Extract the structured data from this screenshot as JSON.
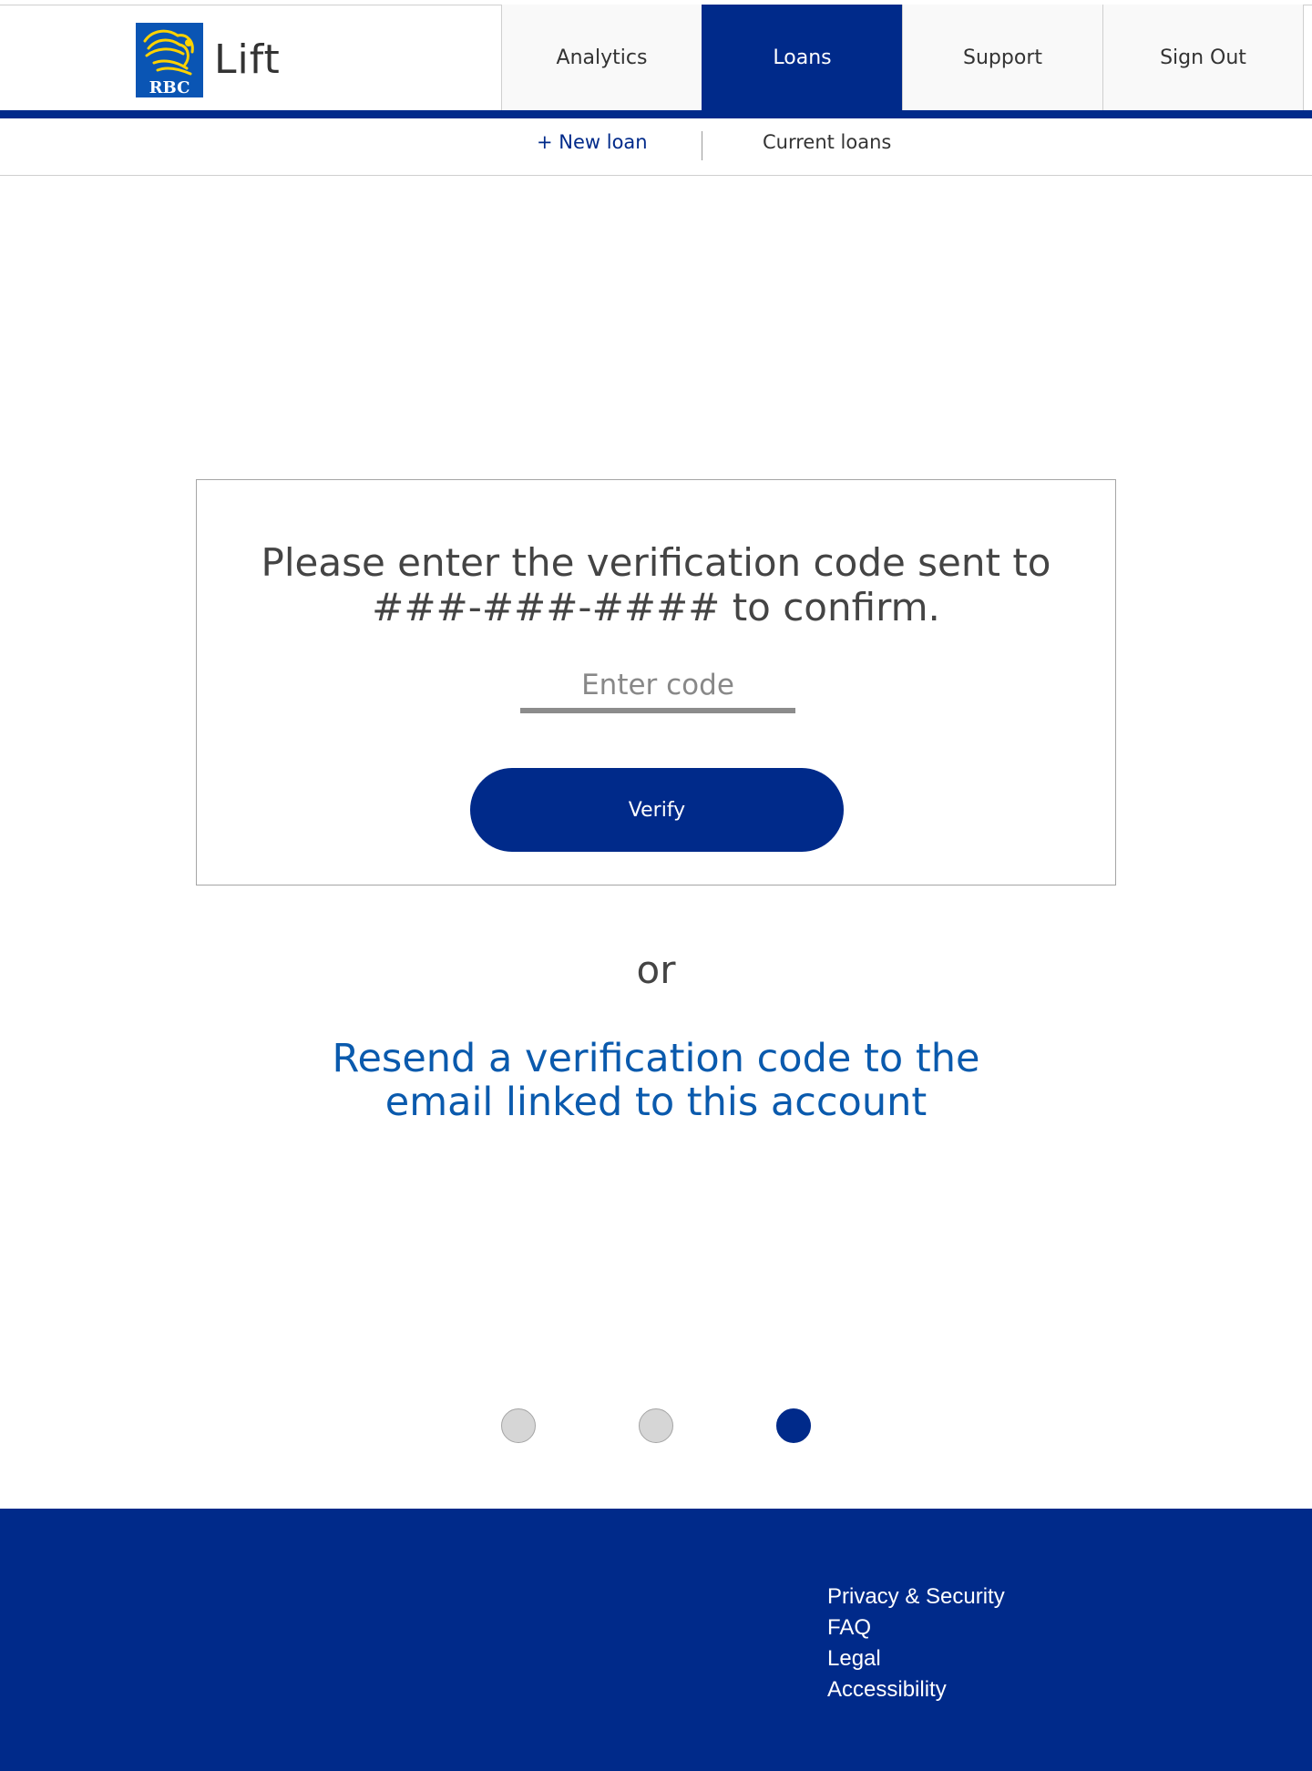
{
  "header": {
    "logo_text": "RBC",
    "app_name": "Lift",
    "nav": [
      {
        "label": "Analytics",
        "active": false
      },
      {
        "label": "Loans",
        "active": true
      },
      {
        "label": "Support",
        "active": false
      },
      {
        "label": "Sign Out",
        "active": false
      }
    ]
  },
  "subnav": {
    "new_loan": "+ New loan",
    "current_loans": "Current loans"
  },
  "verification": {
    "prompt_line1": "Please enter the verification code sent to",
    "prompt_line2": "###-###-#### to confirm.",
    "code_placeholder": "Enter code",
    "code_value": "",
    "verify_label": "Verify"
  },
  "alternative": {
    "or_text": "or",
    "resend_line1": "Resend a verification code to the",
    "resend_line2": "email linked to this account"
  },
  "steps": {
    "total": 3,
    "current": 3
  },
  "footer": {
    "links": [
      "Privacy & Security",
      "FAQ",
      "Legal",
      "Accessibility"
    ]
  },
  "colors": {
    "brand_blue": "#002a8a",
    "link_blue": "#0a5aad",
    "logo_yellow": "#ffd200",
    "inactive_step": "#d6d6d6"
  },
  "icons": {
    "logo": "rbc-lion-shield-icon"
  }
}
